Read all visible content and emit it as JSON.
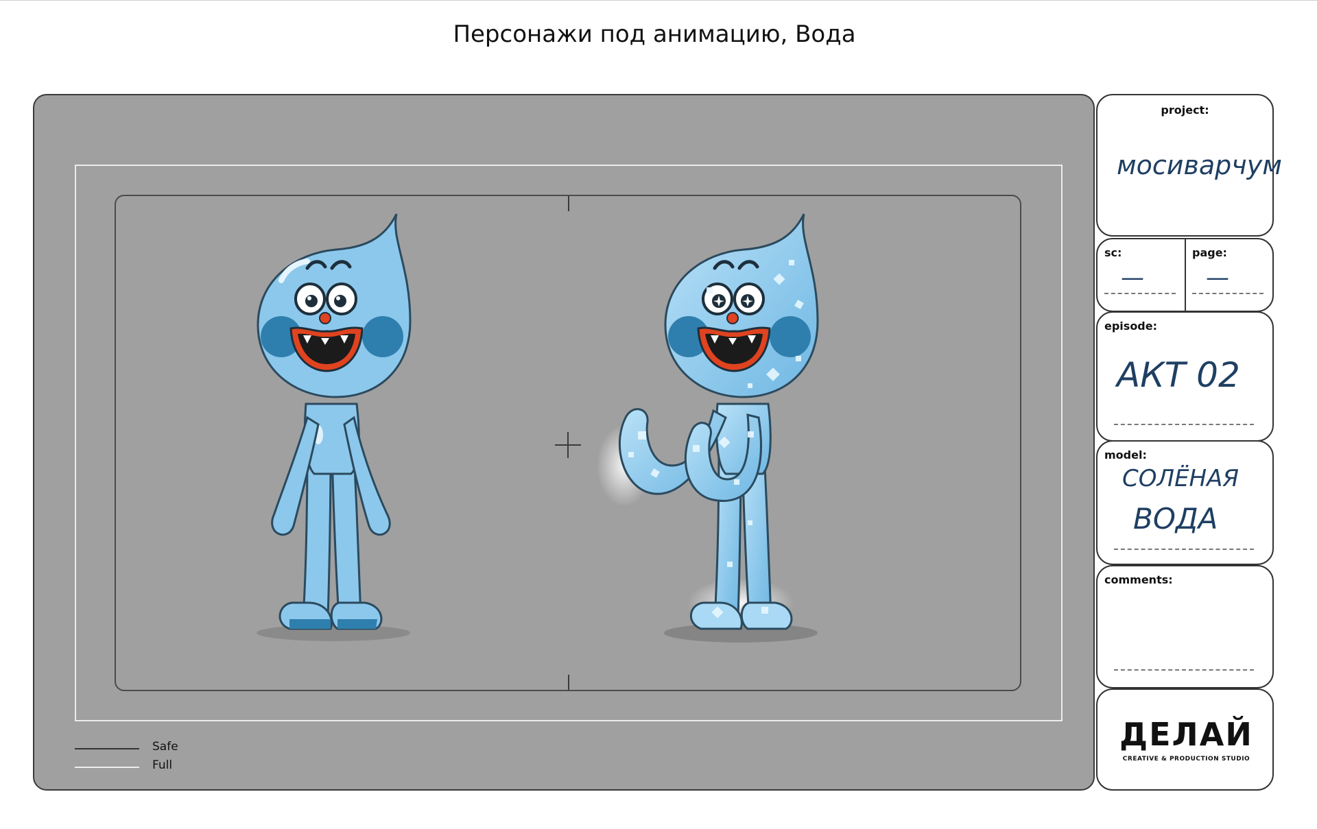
{
  "title": "Персонажи под анимацию, Вода",
  "legend": {
    "safe": "Safe",
    "full": "Full"
  },
  "sheet": {
    "project": {
      "label": "project:",
      "value": "мосиварчум"
    },
    "sc": {
      "label": "sc:",
      "value": "—"
    },
    "page": {
      "label": "page:",
      "value": "—"
    },
    "episode": {
      "label": "episode:",
      "value": "АКТ 02"
    },
    "model": {
      "label": "model:",
      "line1": "СОЛЁНАЯ",
      "line2": "ВОДА"
    },
    "comments": {
      "label": "comments:"
    }
  },
  "logo": {
    "name": "ДЕЛАЙ",
    "tagline": "CREATIVE & PRODUCTION STUDIO"
  },
  "colors": {
    "board_gray": "#a0a0a0",
    "character_blue": "#8cc8ec",
    "cheek_blue": "#2f7fae",
    "mouth_red": "#e0431f",
    "handwriting": "#1f3f63"
  }
}
